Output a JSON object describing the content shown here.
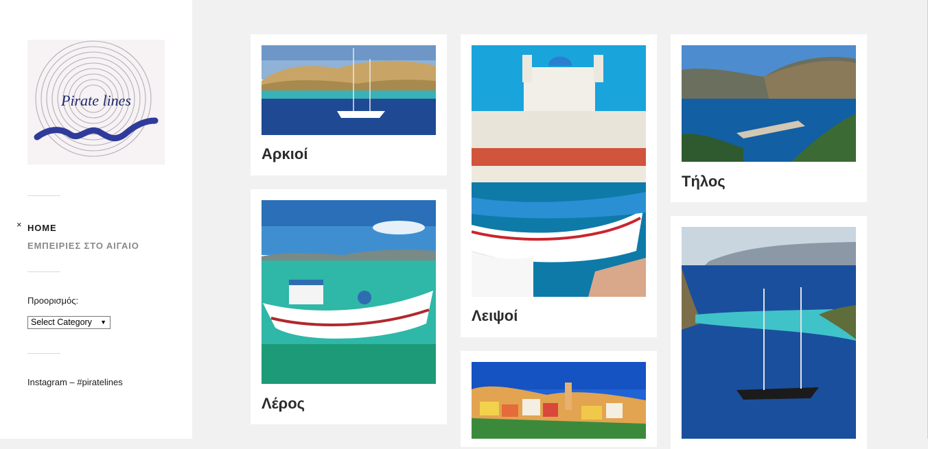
{
  "site": {
    "logo_text": "Pirate lines",
    "logo_icon": "spiral-wave-logo"
  },
  "sidebar": {
    "menu_close_icon": "×",
    "menu": [
      {
        "label": "HOME"
      },
      {
        "label": "ΕΜΠΕΙΡΙΕΣ ΣΤΟ ΑΙΓΑΙΟ"
      }
    ],
    "category_widget_title": "Προορισμός:",
    "category_select_value": "Select Category",
    "instagram_title": "Instagram – #piratelines"
  },
  "posts": [
    {
      "title": "Αρκιοί",
      "image": "sailboat-island-photo"
    },
    {
      "title": "Λέρος",
      "image": "fishing-boat-bay-photo"
    },
    {
      "title": "Λειψοί",
      "image": "harbor-church-boats-photo"
    },
    {
      "title": "",
      "image": "colorful-town-photo"
    },
    {
      "title": "Τήλος",
      "image": "bay-mountains-photo"
    },
    {
      "title": "",
      "image": "yacht-turquoise-sea-photo"
    }
  ],
  "colors": {
    "background": "#f1f1f1",
    "sidebar": "#ffffff",
    "card": "#ffffff",
    "title": "#2b2b2b",
    "menu_secondary": "#888888"
  }
}
